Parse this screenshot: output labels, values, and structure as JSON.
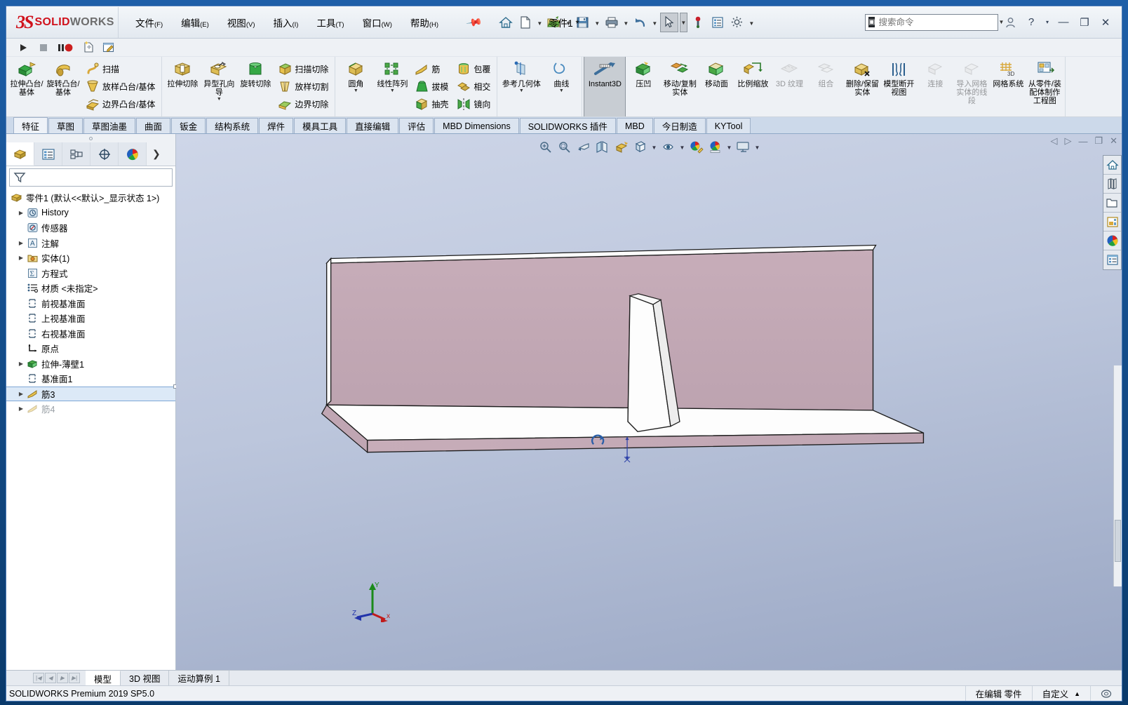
{
  "app": {
    "brand_ds": "3S",
    "brand_solid": "SOLID",
    "brand_works": "WORKS",
    "document_title": "零件1 *",
    "product_version": "SOLIDWORKS Premium 2019 SP5.0"
  },
  "menu": [
    {
      "label": "文件",
      "key": "(F)"
    },
    {
      "label": "编辑",
      "key": "(E)"
    },
    {
      "label": "视图",
      "key": "(V)"
    },
    {
      "label": "插入",
      "key": "(I)"
    },
    {
      "label": "工具",
      "key": "(T)"
    },
    {
      "label": "窗口",
      "key": "(W)"
    },
    {
      "label": "帮助",
      "key": "(H)"
    }
  ],
  "quick_access": [
    {
      "name": "home-icon",
      "caret": false
    },
    {
      "name": "new-document-icon",
      "caret": true
    },
    {
      "name": "open-folder-icon",
      "caret": true
    },
    {
      "name": "save-icon",
      "caret": true
    },
    {
      "name": "print-icon",
      "caret": true
    },
    {
      "name": "undo-icon",
      "caret": true
    },
    {
      "name": "select-cursor-icon",
      "caret": true
    },
    {
      "name": "rebuild-icon",
      "caret": false
    },
    {
      "name": "options-list-icon",
      "caret": false
    },
    {
      "name": "gear-settings-icon",
      "caret": true
    }
  ],
  "search": {
    "placeholder": "搜索命令",
    "value": ""
  },
  "window_buttons": {
    "user": "user-icon",
    "help": "?",
    "help_caret": "▾",
    "minimize": "—",
    "maximize": "❐",
    "close": "✕"
  },
  "macro_bar": [
    "macro-run-icon",
    "macro-stop-icon",
    "macro-pause-record-icon",
    "macro-new-icon",
    "macro-edit-icon"
  ],
  "ribbon": {
    "groups": [
      {
        "big": [
          {
            "label": "拉伸凸台/基体",
            "icon": "extrude-boss-icon",
            "caret": false
          },
          {
            "label": "旋转凸台/基体",
            "icon": "revolve-boss-icon",
            "caret": false
          }
        ],
        "small": [
          {
            "label": "扫描",
            "icon": "sweep-icon"
          },
          {
            "label": "放样凸台/基体",
            "icon": "loft-boss-icon"
          },
          {
            "label": "边界凸台/基体",
            "icon": "boundary-boss-icon"
          }
        ]
      },
      {
        "big": [
          {
            "label": "拉伸切除",
            "icon": "extrude-cut-icon",
            "caret": false
          },
          {
            "label": "异型孔向导",
            "icon": "hole-wizard-icon",
            "caret": true
          },
          {
            "label": "旋转切除",
            "icon": "revolve-cut-icon",
            "caret": false
          }
        ],
        "small": [
          {
            "label": "扫描切除",
            "icon": "sweep-cut-icon"
          },
          {
            "label": "放样切割",
            "icon": "loft-cut-icon"
          },
          {
            "label": "边界切除",
            "icon": "boundary-cut-icon"
          }
        ]
      },
      {
        "big": [
          {
            "label": "圆角",
            "icon": "fillet-icon",
            "caret": true
          },
          {
            "label": "线性阵列",
            "icon": "linear-pattern-icon",
            "caret": true
          }
        ],
        "small": [
          {
            "label": "筋",
            "icon": "rib-icon"
          },
          {
            "label": "拔模",
            "icon": "draft-icon"
          },
          {
            "label": "抽壳",
            "icon": "shell-icon"
          }
        ],
        "small2": [
          {
            "label": "包覆",
            "icon": "wrap-icon"
          },
          {
            "label": "相交",
            "icon": "intersect-icon"
          },
          {
            "label": "镜向",
            "icon": "mirror-icon"
          }
        ]
      },
      {
        "big": [
          {
            "label": "参考几何体",
            "icon": "reference-geometry-icon",
            "caret": true
          },
          {
            "label": "曲线",
            "icon": "curves-icon",
            "caret": true
          }
        ],
        "small": []
      },
      {
        "big": [
          {
            "label": "Instant3D",
            "icon": "instant3d-icon",
            "caret": false,
            "active": true
          },
          {
            "label": "压凹",
            "icon": "indent-icon",
            "caret": false
          },
          {
            "label": "移动/复制实体",
            "icon": "move-copy-body-icon",
            "caret": false
          },
          {
            "label": "移动面",
            "icon": "move-face-icon",
            "caret": false
          },
          {
            "label": "比例缩放",
            "icon": "scale-icon",
            "caret": false
          },
          {
            "label": "3D 纹理",
            "icon": "texture-3d-icon",
            "caret": false,
            "disabled": true
          },
          {
            "label": "组合",
            "icon": "combine-icon",
            "caret": false,
            "disabled": true
          },
          {
            "label": "删除/保留实体",
            "icon": "delete-keep-body-icon",
            "caret": false
          },
          {
            "label": "模型断开视图",
            "icon": "model-break-view-icon",
            "caret": false
          },
          {
            "label": "连接",
            "icon": "join-icon",
            "caret": false,
            "disabled": true
          },
          {
            "label": "导入网格实体的线段",
            "icon": "import-mesh-segment-icon",
            "caret": false,
            "disabled": true
          },
          {
            "label": "网格系统",
            "icon": "mesh-system-icon",
            "caret": false
          },
          {
            "label": "从零件/装配体制作工程图",
            "icon": "make-drawing-icon",
            "caret": false
          }
        ],
        "small": []
      }
    ]
  },
  "command_tabs": [
    {
      "label": "特征",
      "selected": true
    },
    {
      "label": "草图",
      "selected": false
    },
    {
      "label": "草图油墨",
      "selected": false
    },
    {
      "label": "曲面",
      "selected": false
    },
    {
      "label": "钣金",
      "selected": false
    },
    {
      "label": "结构系统",
      "selected": false
    },
    {
      "label": "焊件",
      "selected": false
    },
    {
      "label": "模具工具",
      "selected": false
    },
    {
      "label": "直接编辑",
      "selected": false
    },
    {
      "label": "评估",
      "selected": false
    },
    {
      "label": "MBD Dimensions",
      "selected": false
    },
    {
      "label": "SOLIDWORKS 插件",
      "selected": false
    },
    {
      "label": "MBD",
      "selected": false
    },
    {
      "label": "今日制造",
      "selected": false
    },
    {
      "label": "KYTool",
      "selected": false
    }
  ],
  "tree_panel": {
    "tabs": [
      {
        "name": "feature-manager-tab",
        "icon": "feature-tree-icon",
        "selected": true
      },
      {
        "name": "property-manager-tab",
        "icon": "property-list-icon",
        "selected": false
      },
      {
        "name": "configuration-manager-tab",
        "icon": "configuration-icon",
        "selected": false
      },
      {
        "name": "dimxpert-manager-tab",
        "icon": "dimxpert-icon",
        "selected": false
      },
      {
        "name": "display-manager-tab",
        "icon": "appearance-sphere-icon",
        "selected": false
      }
    ],
    "more": "❯",
    "filter_placeholder": "",
    "items": [
      {
        "label": "零件1  (默认<<默认>_显示状态 1>)",
        "icon": "part-icon",
        "arrow": false,
        "indent": 0,
        "dim": false,
        "selected": false
      },
      {
        "label": "History",
        "icon": "history-icon",
        "arrow": true,
        "indent": 1,
        "dim": false,
        "selected": false
      },
      {
        "label": "传感器",
        "icon": "sensor-icon",
        "arrow": false,
        "indent": 1,
        "dim": false,
        "selected": false
      },
      {
        "label": "注解",
        "icon": "annotation-icon",
        "arrow": true,
        "indent": 1,
        "dim": false,
        "selected": false
      },
      {
        "label": "实体(1)",
        "icon": "solid-bodies-icon",
        "arrow": true,
        "indent": 1,
        "dim": false,
        "selected": false
      },
      {
        "label": "方程式",
        "icon": "equations-icon",
        "arrow": false,
        "indent": 1,
        "dim": false,
        "selected": false
      },
      {
        "label": "材质 <未指定>",
        "icon": "material-icon",
        "arrow": false,
        "indent": 1,
        "dim": false,
        "selected": false
      },
      {
        "label": "前视基准面",
        "icon": "plane-icon",
        "arrow": false,
        "indent": 1,
        "dim": false,
        "selected": false
      },
      {
        "label": "上视基准面",
        "icon": "plane-icon",
        "arrow": false,
        "indent": 1,
        "dim": false,
        "selected": false
      },
      {
        "label": "右视基准面",
        "icon": "plane-icon",
        "arrow": false,
        "indent": 1,
        "dim": false,
        "selected": false
      },
      {
        "label": "原点",
        "icon": "origin-icon",
        "arrow": false,
        "indent": 1,
        "dim": false,
        "selected": false
      },
      {
        "label": "拉伸-薄壁1",
        "icon": "extrude-thin-icon",
        "arrow": true,
        "indent": 1,
        "dim": false,
        "selected": false
      },
      {
        "label": "基准面1",
        "icon": "plane-icon",
        "arrow": false,
        "indent": 1,
        "dim": false,
        "selected": false
      },
      {
        "label": "筋3",
        "icon": "rib-feature-icon",
        "arrow": true,
        "indent": 1,
        "dim": false,
        "selected": true
      },
      {
        "label": "筋4",
        "icon": "rib-feature-icon",
        "arrow": true,
        "indent": 1,
        "dim": true,
        "selected": false
      }
    ]
  },
  "view_toolbar": [
    {
      "name": "zoom-to-fit-icon",
      "caret": false
    },
    {
      "name": "zoom-to-area-icon",
      "caret": false
    },
    {
      "name": "previous-view-icon",
      "caret": false
    },
    {
      "name": "section-view-icon",
      "caret": false
    },
    {
      "name": "view-orientation-icon",
      "caret": false
    },
    {
      "name": "display-style-icon",
      "caret": true
    },
    {
      "name": "hide-show-items-icon",
      "caret": true
    },
    {
      "name": "edit-appearance-icon",
      "caret": true
    },
    {
      "name": "apply-scene-icon",
      "caret": true
    },
    {
      "name": "view-settings-icon",
      "caret": true
    }
  ],
  "gfx_window_buttons": [
    "scroll-left-icon",
    "scroll-right-icon",
    "minimize-doc-icon",
    "restore-doc-icon",
    "close-doc-icon"
  ],
  "view_selector_strip": [
    {
      "name": "home-view-icon"
    },
    {
      "name": "display-pane-icon"
    },
    {
      "name": "open-folder-view-icon"
    },
    {
      "name": "appearances-library-icon"
    },
    {
      "name": "appearance-sphere-icon"
    },
    {
      "name": "custom-properties-icon"
    }
  ],
  "triad": {
    "x_label": "x",
    "y_label": "Y",
    "z_label": "Z"
  },
  "bottom_tabs": [
    {
      "label": "模型",
      "selected": true
    },
    {
      "label": "3D 视图",
      "selected": false
    },
    {
      "label": "运动算例 1",
      "selected": false
    }
  ],
  "status_bar": {
    "left": "SOLIDWORKS Premium 2019 SP5.0",
    "edit_state": "在编辑 零件",
    "units": "自定义",
    "units_caret": "▲"
  },
  "model": {
    "description": "薄壁 L 形钣金件含三角筋板",
    "face_color": "#c3a8b4",
    "edge_color": "#1a1a1a",
    "white_face": "#fdfdfd"
  }
}
